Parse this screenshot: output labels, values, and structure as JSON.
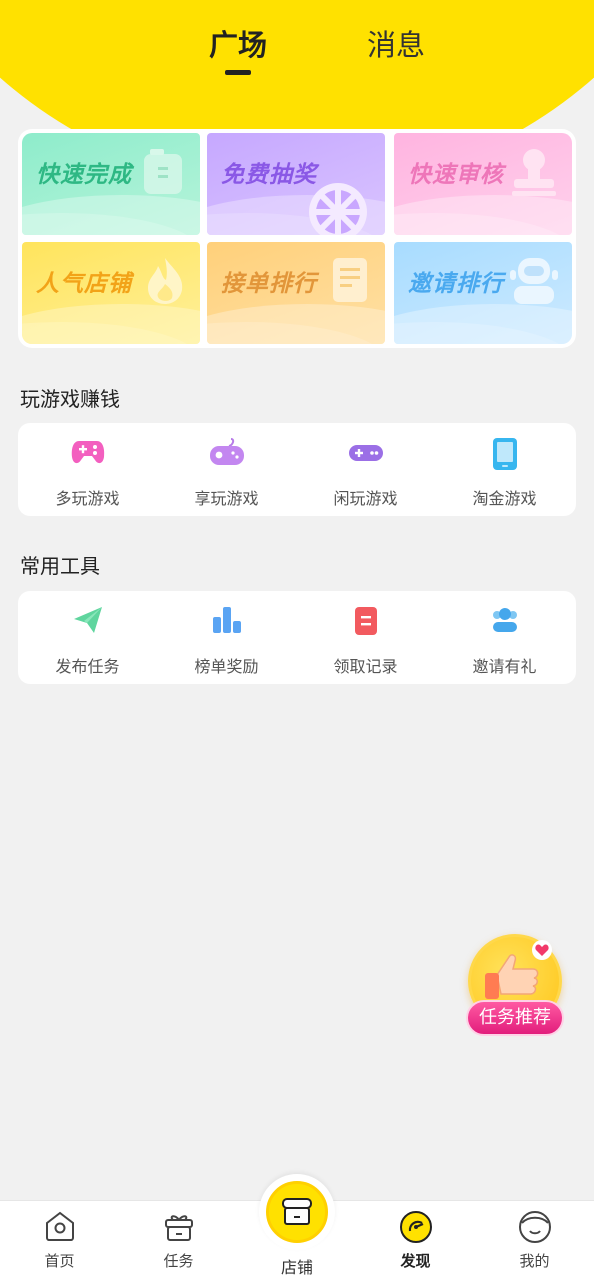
{
  "colors": {
    "header": "#ffe100",
    "background": "#f1f1f1",
    "float_pill": "#e21d7c"
  },
  "top_tabs": [
    {
      "label": "广场",
      "active": true
    },
    {
      "label": "消息",
      "active": false
    }
  ],
  "banners": [
    {
      "label": "快速完成",
      "icon": "battery-icon"
    },
    {
      "label": "免费抽奖",
      "icon": "prize-wheel-icon"
    },
    {
      "label": "快速审核",
      "icon": "stamp-icon"
    },
    {
      "label": "人气店铺",
      "icon": "flame-icon"
    },
    {
      "label": "接单排行",
      "icon": "document-icon"
    },
    {
      "label": "邀请排行",
      "icon": "robot-icon"
    }
  ],
  "games_section": {
    "title": "玩游戏赚钱",
    "items": [
      {
        "label": "多玩游戏",
        "icon": "gamepad-icon"
      },
      {
        "label": "享玩游戏",
        "icon": "joystick-icon"
      },
      {
        "label": "闲玩游戏",
        "icon": "controller-icon"
      },
      {
        "label": "淘金游戏",
        "icon": "tablet-icon"
      }
    ]
  },
  "tools_section": {
    "title": "常用工具",
    "items": [
      {
        "label": "发布任务",
        "icon": "paper-plane-icon"
      },
      {
        "label": "榜单奖励",
        "icon": "bar-chart-icon"
      },
      {
        "label": "领取记录",
        "icon": "record-icon"
      },
      {
        "label": "邀请有礼",
        "icon": "people-icon"
      }
    ]
  },
  "float_button": {
    "label": "任务推荐",
    "icon": "thumbs-up-icon"
  },
  "bottom_nav": [
    {
      "label": "首页",
      "icon": "home-icon"
    },
    {
      "label": "任务",
      "icon": "gift-box-icon"
    },
    {
      "label": "店铺",
      "icon": "store-icon"
    },
    {
      "label": "发现",
      "icon": "compass-icon",
      "active": true
    },
    {
      "label": "我的",
      "icon": "profile-icon"
    }
  ]
}
